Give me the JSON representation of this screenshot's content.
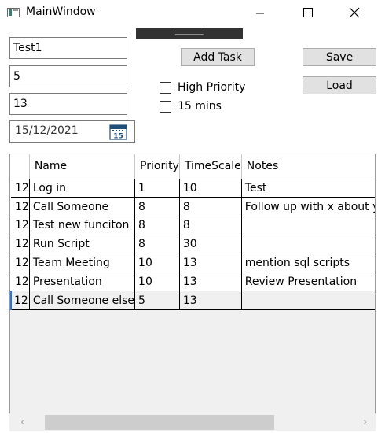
{
  "window": {
    "title": "MainWindow"
  },
  "form": {
    "name_value": "Test1",
    "priority_value": "5",
    "timescale_value": "13",
    "date_value": "15/12/2021",
    "calendar_day": "15"
  },
  "buttons": {
    "add_task": "Add Task",
    "save": "Save",
    "load": "Load"
  },
  "checkboxes": {
    "high_priority": "High Priority",
    "fifteen_mins": "15 mins"
  },
  "grid": {
    "columns": [
      "Name",
      "Priority",
      "TimeScale",
      "Notes"
    ],
    "rows": [
      {
        "hdr": "12",
        "name": "Log in",
        "priority": "1",
        "timescale": "10",
        "notes": "Test"
      },
      {
        "hdr": "12",
        "name": "Call Someone",
        "priority": "8",
        "timescale": "8",
        "notes": "Follow up with x about y"
      },
      {
        "hdr": "12",
        "name": "Test new funciton",
        "priority": "8",
        "timescale": "8",
        "notes": ""
      },
      {
        "hdr": "12",
        "name": "Run Script",
        "priority": "8",
        "timescale": "30",
        "notes": ""
      },
      {
        "hdr": "12",
        "name": "Team Meeting",
        "priority": "10",
        "timescale": "13",
        "notes": "mention sql scripts"
      },
      {
        "hdr": "12",
        "name": "Presentation",
        "priority": "10",
        "timescale": "13",
        "notes": "Review Presentation"
      },
      {
        "hdr": "12",
        "name": "Call Someone else",
        "priority": "5",
        "timescale": "13",
        "notes": ""
      }
    ]
  },
  "colors": {
    "selection_accent": "#1e7ae0",
    "button_face": "#e1e1e1",
    "grid_background": "#f0f0f0"
  },
  "icons": {
    "app": "window-app-icon",
    "calendar": "calendar-icon",
    "minimize": "minimize-icon",
    "maximize": "maximize-icon",
    "close": "close-icon"
  }
}
